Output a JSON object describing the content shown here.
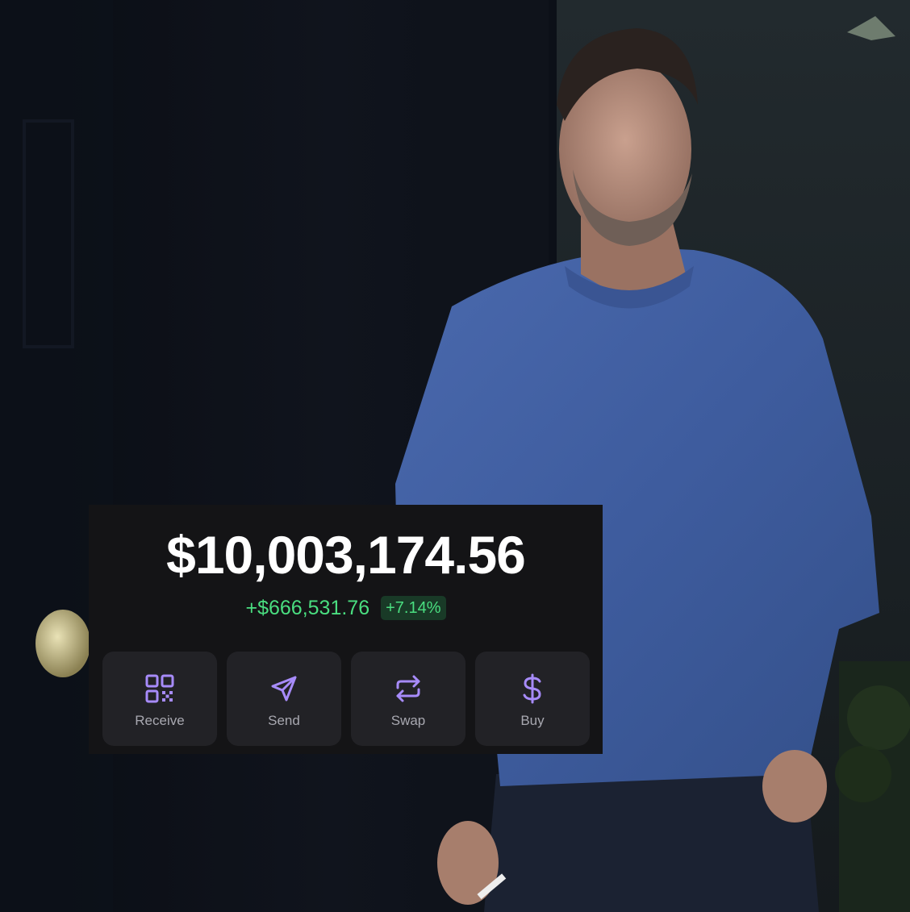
{
  "wallet": {
    "balance": "$10,003,174.56",
    "change_amount": "+$666,531.76",
    "change_percent": "+7.14%",
    "accent_color": "#a78bfa",
    "positive_color": "#4ade80",
    "actions": [
      {
        "label": "Receive",
        "icon": "qr-code-icon"
      },
      {
        "label": "Send",
        "icon": "paper-plane-icon"
      },
      {
        "label": "Swap",
        "icon": "swap-arrows-icon"
      },
      {
        "label": "Buy",
        "icon": "dollar-icon"
      }
    ]
  }
}
